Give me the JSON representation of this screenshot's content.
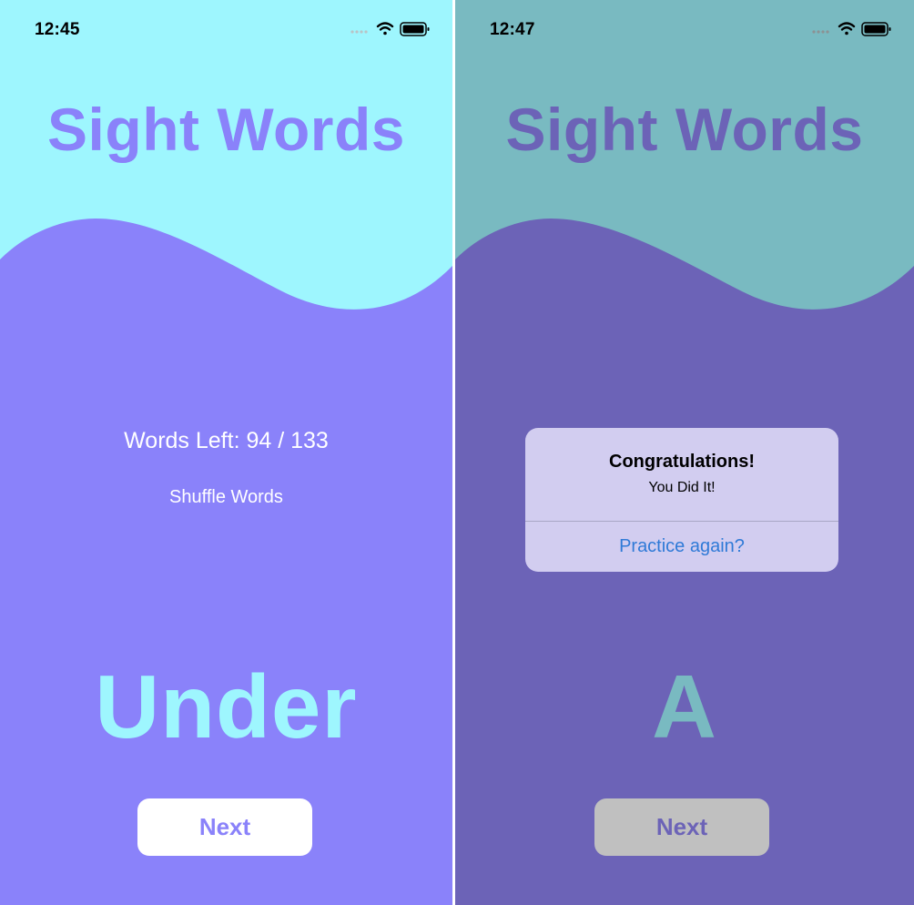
{
  "colors": {
    "sky": "#9ef6fe",
    "purple": "#8a82fa",
    "dim_sky": "#79bac1",
    "dim_purple": "#6c63b7",
    "white": "#ffffff",
    "dim_button": "#c0c0c0",
    "alert_link": "#2f7ad7"
  },
  "left_screen": {
    "status": {
      "time": "12:45",
      "icons": [
        "cellular-dots-icon",
        "wifi-icon",
        "battery-icon"
      ]
    },
    "title": "Sight Words",
    "words_left": "Words Left: 94 / 133",
    "shuffle_label": "Shuffle Words",
    "current_word": "Under",
    "next_label": "Next"
  },
  "right_screen": {
    "status": {
      "time": "12:47",
      "icons": [
        "cellular-dots-icon",
        "wifi-icon",
        "battery-icon"
      ]
    },
    "title": "Sight Words",
    "current_word": "A",
    "next_label": "Next",
    "alert": {
      "title": "Congratulations!",
      "message": "You Did It!",
      "action_label": "Practice again?"
    }
  }
}
